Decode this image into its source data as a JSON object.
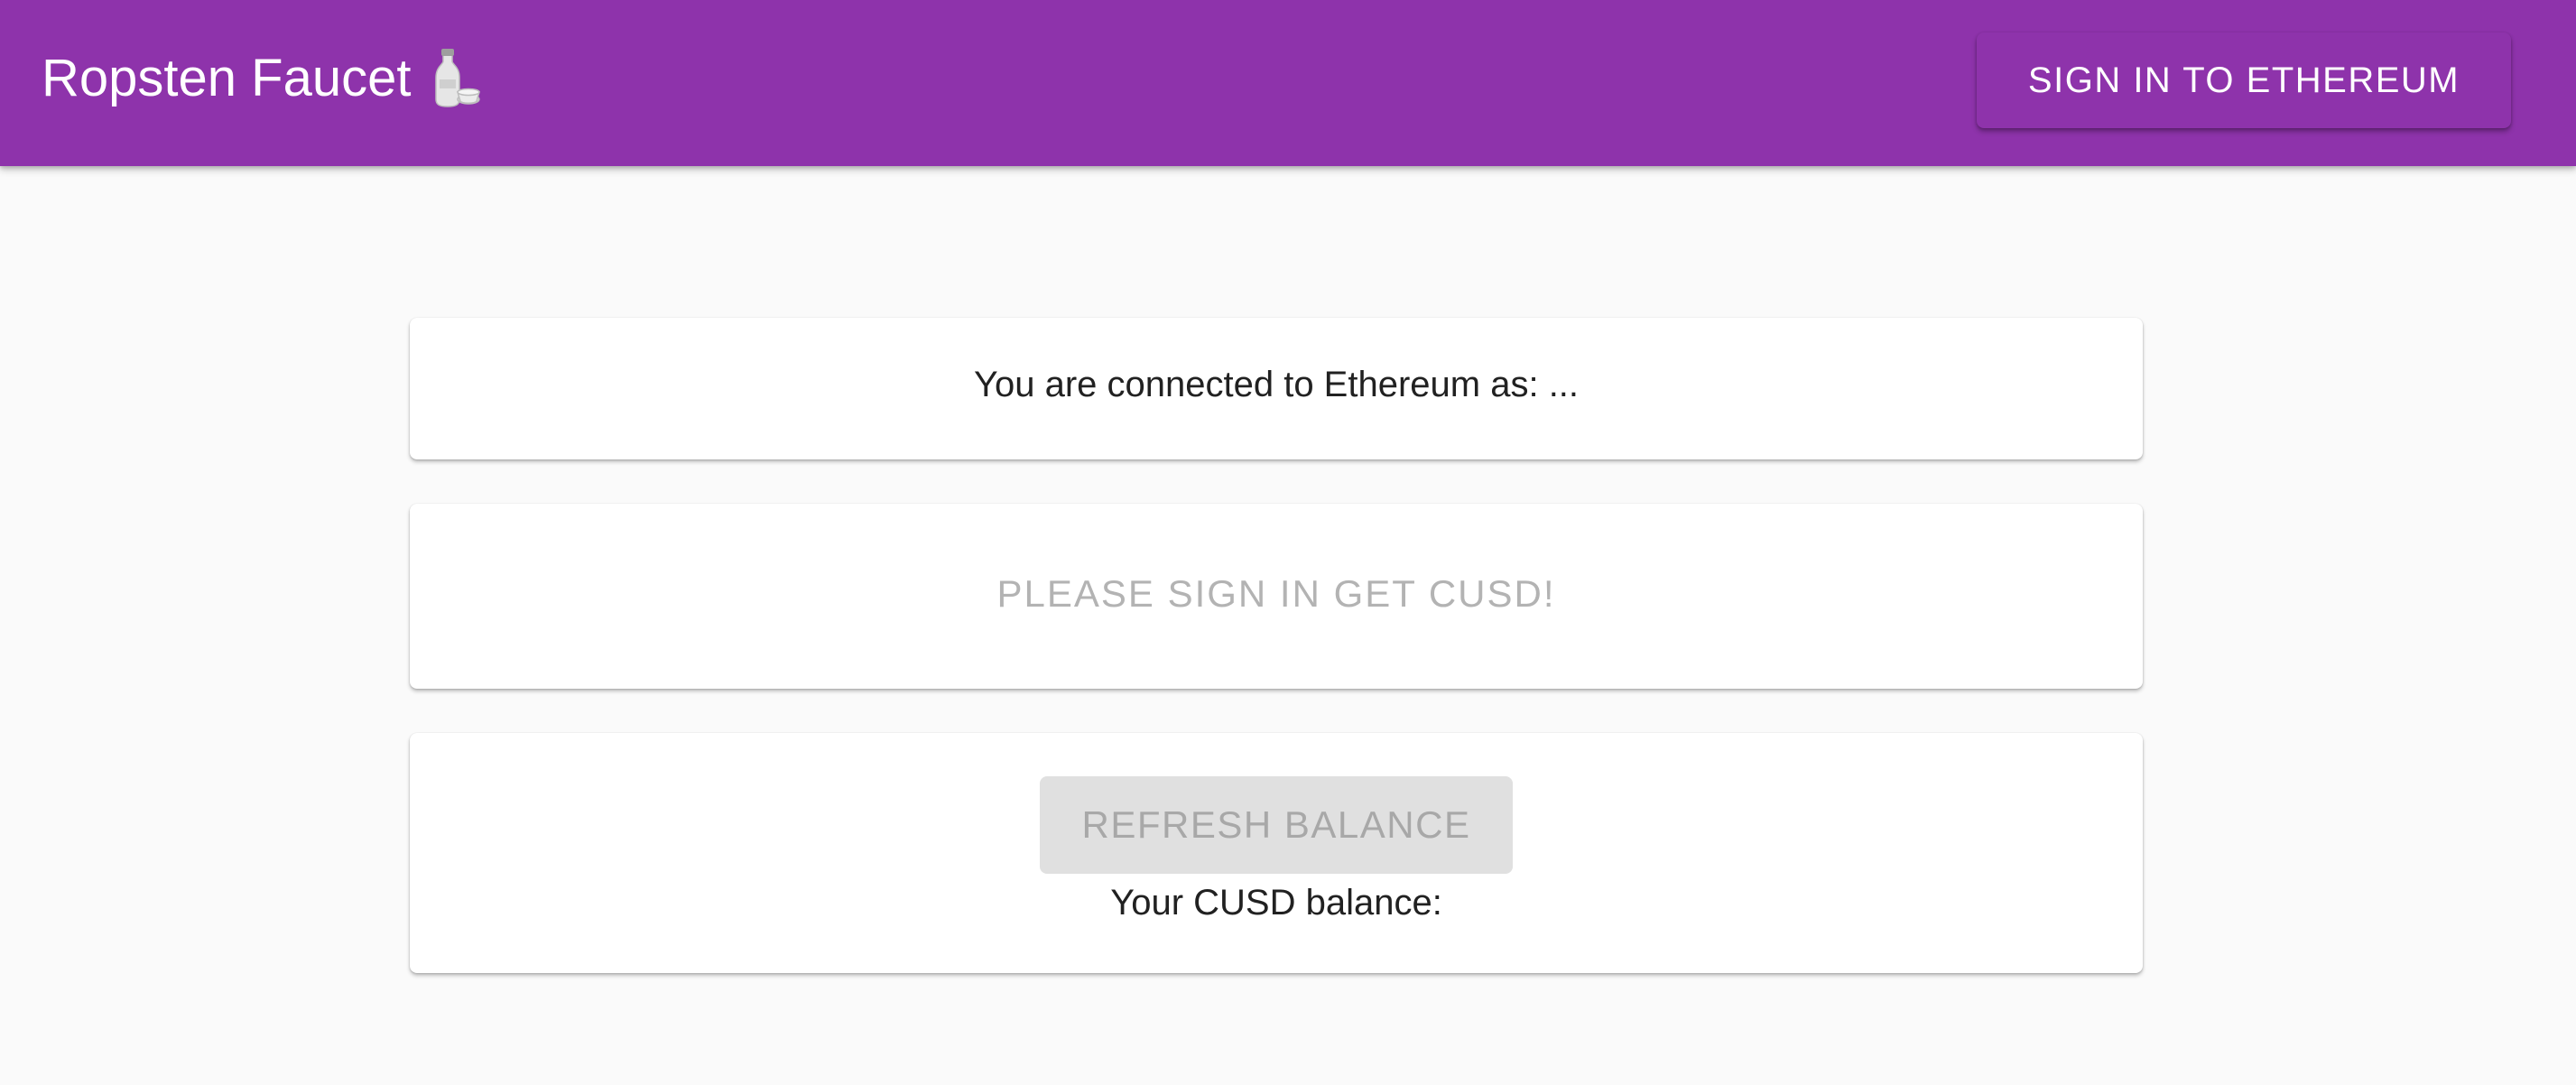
{
  "colors": {
    "primary": "#8e33ab",
    "page_background": "#fafafa",
    "card_background": "#ffffff",
    "disabled_button_bg": "#e0e0e0",
    "disabled_text": "#a8a8a8"
  },
  "header": {
    "title": "Ropsten Faucet",
    "title_icon": "sake-bottle-icon",
    "sign_in_label": "SIGN IN TO ETHEREUM"
  },
  "connection_card": {
    "status_text": "You are connected to Ethereum as: ..."
  },
  "request_card": {
    "button_label": "PLEASE SIGN IN GET CUSD!"
  },
  "balance_card": {
    "refresh_label": "REFRESH BALANCE",
    "balance_text": "Your CUSD balance:"
  }
}
